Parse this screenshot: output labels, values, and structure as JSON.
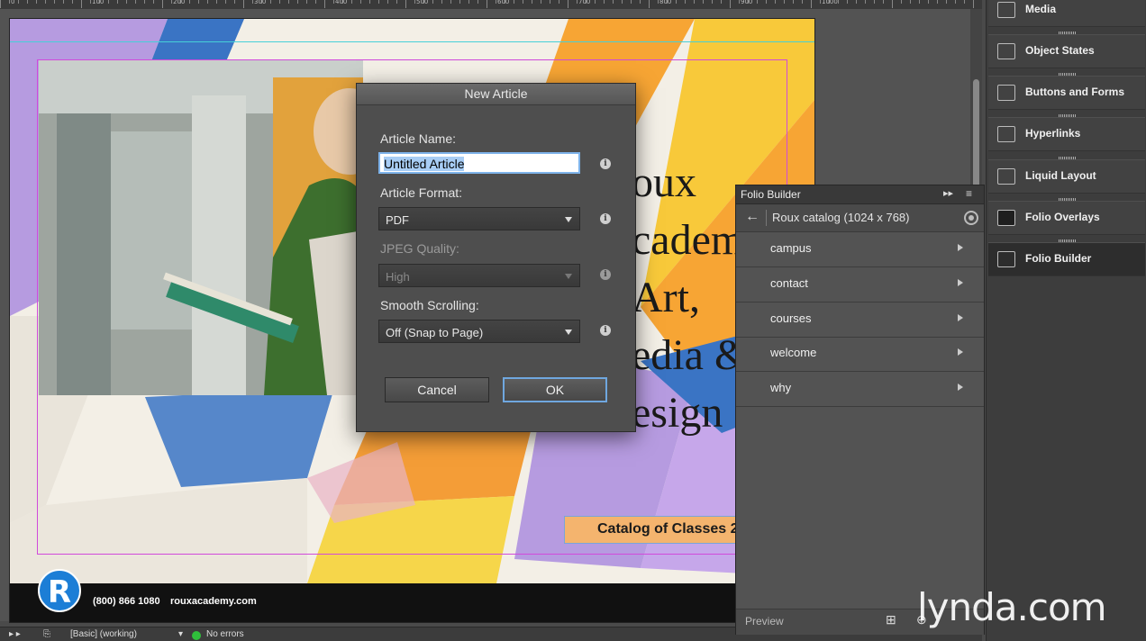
{
  "ruler": {
    "numbers": [
      "0",
      "100",
      "200",
      "300",
      "400",
      "500",
      "600",
      "700",
      "800",
      "900",
      "1000"
    ]
  },
  "page": {
    "title_lines": [
      "oux",
      "cadem",
      "Art,",
      "edia &",
      "esign"
    ],
    "catalog_label": "Catalog of Classes 2",
    "phone": "(800) 866 1080",
    "website": "rouxacademy.com",
    "logo_letter": "R"
  },
  "dialog": {
    "title": "New Article",
    "article_name_label": "Article Name:",
    "article_name_value": "Untitled Article",
    "article_format_label": "Article Format:",
    "article_format_value": "PDF",
    "jpeg_quality_label": "JPEG Quality:",
    "jpeg_quality_value": "High",
    "smooth_scrolling_label": "Smooth Scrolling:",
    "smooth_scrolling_value": "Off (Snap to Page)",
    "cancel_label": "Cancel",
    "ok_label": "OK",
    "info_glyph": "i"
  },
  "folio_builder": {
    "tab_title": "Folio Builder",
    "collapse_glyph": "▸▸",
    "menu_glyph": "≡",
    "back_glyph": "←",
    "folio_name": "Roux catalog (1024 x 768)",
    "articles": [
      "campus",
      "contact",
      "courses",
      "welcome",
      "why"
    ],
    "preview_label": "Preview",
    "new_glyph": "⊞",
    "add_glyph": "⊕"
  },
  "dock": {
    "items": [
      {
        "label": "Media",
        "active": false
      },
      {
        "label": "Object States",
        "active": false
      },
      {
        "label": "Buttons and Forms",
        "active": false
      },
      {
        "label": "Hyperlinks",
        "active": false
      },
      {
        "label": "Liquid Layout",
        "active": false
      },
      {
        "label": "Folio Overlays",
        "active": false
      },
      {
        "label": "Folio Builder",
        "active": true
      }
    ]
  },
  "statusbar": {
    "page_state": "[Basic] (working)",
    "errors": "No errors"
  },
  "watermark": "lynda.com",
  "colors": {
    "guide": "#46d0d8",
    "margin": "#d14adb",
    "accent_blue": "#1c7ed6",
    "ok_border": "#6fa7df"
  }
}
